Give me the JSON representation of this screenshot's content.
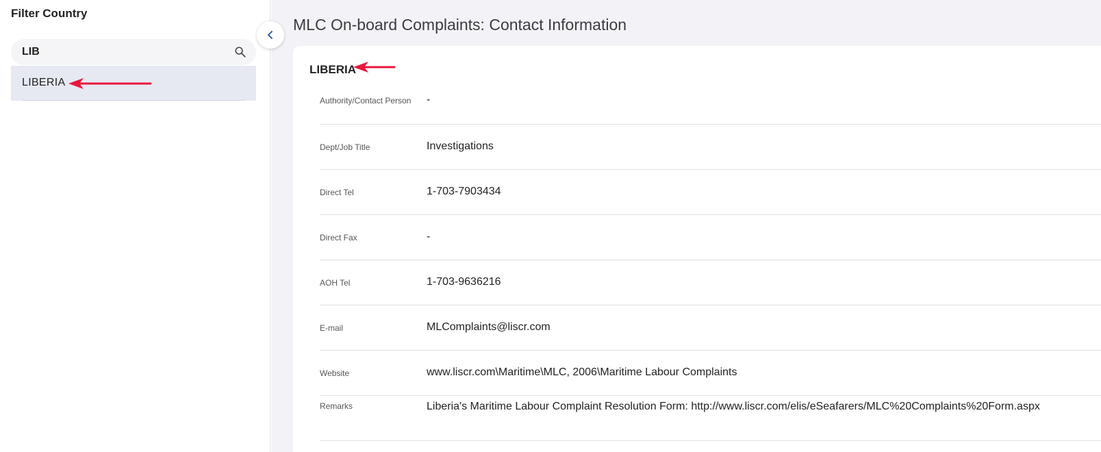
{
  "sidebar": {
    "title": "Filter Country",
    "search": {
      "value": "LIB",
      "placeholder": ""
    },
    "results": [
      {
        "label": "LIBERIA"
      }
    ]
  },
  "main": {
    "title": "MLC On-board Complaints: Contact Information",
    "country": "LIBERIA",
    "fields": [
      {
        "label": "Authority/Contact Person",
        "value": "-"
      },
      {
        "label": "Dept/Job Title",
        "value": "Investigations"
      },
      {
        "label": "Direct Tel",
        "value": "1-703-7903434"
      },
      {
        "label": "Direct Fax",
        "value": "-"
      },
      {
        "label": "AOH Tel",
        "value": "1-703-9636216"
      },
      {
        "label": "E-mail",
        "value": "MLComplaints@liscr.com"
      },
      {
        "label": "Website",
        "value": "www.liscr.com\\Maritime\\MLC, 2006\\Maritime Labour Complaints"
      },
      {
        "label": "Remarks",
        "value": "Liberia's Maritime Labour Complaint Resolution Form: http://www.liscr.com/elis/eSeafarers/MLC%20Complaints%20Form.aspx"
      }
    ]
  },
  "icons": {
    "search": "search-icon",
    "collapse": "chevron-left-icon",
    "annotation": "red-arrow-icon"
  },
  "colors": {
    "annotation_arrow": "#e8173b",
    "selected_row": "#e6e9f2",
    "main_background": "#f3f3f7",
    "collapse_chevron": "#1f4f9a"
  }
}
